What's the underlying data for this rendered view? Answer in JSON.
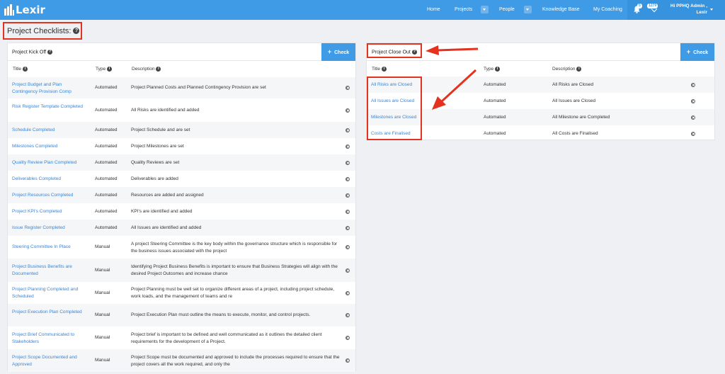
{
  "app": {
    "logo_text": "Lexir"
  },
  "nav": {
    "items": [
      "Home",
      "Projects",
      "People",
      "Knowledge Base",
      "My Coaching"
    ],
    "notifications_count": "5",
    "messages_count": "1279",
    "user_line1": "Hi PPHQ Admin ,",
    "user_line2": "Lexir"
  },
  "page": {
    "title": "Project Checklists:"
  },
  "kickoff": {
    "title": "Project Kick Off",
    "check_label": "Check",
    "columns": [
      "Title",
      "Type",
      "Description"
    ],
    "rows": [
      {
        "title": "Project Budget and Plan Contingency Provision Comp",
        "type": "Automated",
        "description": "Project Planned Costs and Planned Contingency Provision are set"
      },
      {
        "title": "Risk Register Template Completed",
        "type": "Automated",
        "description": "All Risks are identified and added"
      },
      {
        "title": "Schedule Completed",
        "type": "Automated",
        "description": "Project Schedule and are set"
      },
      {
        "title": "Milestones Completed",
        "type": "Automated",
        "description": "Project Milestones are set"
      },
      {
        "title": "Quality Review Plan Completed",
        "type": "Automated",
        "description": "Quality Reviews are set"
      },
      {
        "title": "Deliverables Completed",
        "type": "Automated",
        "description": "Deliverables are added"
      },
      {
        "title": "Project Resources Completed",
        "type": "Automated",
        "description": "Resources are added and assigned"
      },
      {
        "title": "Project KPI's Completed",
        "type": "Automated",
        "description": "KPI's are identified and added"
      },
      {
        "title": "Issue Register Completed",
        "type": "Automated",
        "description": "All Issues are identified and added"
      },
      {
        "title": "Steering Committee In Place",
        "type": "Manual",
        "description": "A project Steering Committee is the key body within the governance structure which is responsible for the business issues associated with the project"
      },
      {
        "title": "Project Business Benefits are Documented",
        "type": "Manual",
        "description": "Identifying Project Business Benefits is important to ensure that Business Strategies will align with the desired Project Outcomes and increase chance"
      },
      {
        "title": "Project Planning Completed and Scheduled",
        "type": "Manual",
        "description": "Project Planning must be well set to organize different areas of a project, including project schedule, work loads, and the management of teams and re"
      },
      {
        "title": "Project Execution Plan Completed",
        "type": "Manual",
        "description": "Project Execution Plan must outline the means to execute, monitor, and control projects."
      },
      {
        "title": "Project Brief Communicated to Stakeholders",
        "type": "Manual",
        "description": "Project brief is important to be defined and well communicated as it outlines the detailed client requirements for the development of a Project."
      },
      {
        "title": "Project Scope Documented and Approved",
        "type": "Manual",
        "description": "Project Scope must be documented and approved to include the processes required to ensure that the project covers all the work required, and only the"
      }
    ]
  },
  "closeout": {
    "title": "Project Close Out",
    "check_label": "Check",
    "columns": [
      "Title",
      "Type",
      "Description"
    ],
    "rows": [
      {
        "title": "All Risks are Closed",
        "type": "Automated",
        "description": "All Risks are Closed"
      },
      {
        "title": "All Issues are Closed",
        "type": "Automated",
        "description": "All Issues are Closed"
      },
      {
        "title": "Milestones are Closed",
        "type": "Automated",
        "description": "All Milestone are Completed"
      },
      {
        "title": "Costs are Finalised",
        "type": "Automated",
        "description": "All Costs are Finalised"
      }
    ]
  },
  "colors": {
    "accent": "#3f9be6",
    "link": "#3b84d4",
    "annotation": "#e5321f"
  }
}
